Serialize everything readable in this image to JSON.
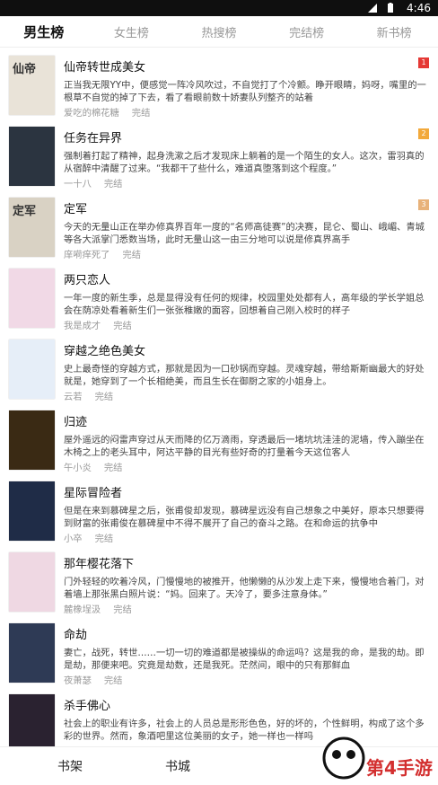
{
  "status_bar": {
    "time": "4:46"
  },
  "tabs": [
    {
      "label": "男生榜",
      "active": true
    },
    {
      "label": "女生榜",
      "active": false
    },
    {
      "label": "热搜榜",
      "active": false
    },
    {
      "label": "完结榜",
      "active": false
    },
    {
      "label": "新书榜",
      "active": false
    }
  ],
  "books": [
    {
      "title": "仙帝转世成美女",
      "desc": "正当我无限YY中，便感觉一阵冷风吹过，不自觉打了个冷颤。睁开眼睛，妈呀，嘴里的一根草不自觉的掉了下去，看了看眼前数十娇妻队列整齐的站着",
      "author": "爱吃的棉花糖",
      "status": "完结",
      "rank": "1",
      "rank_color": "#e53935",
      "cover_color": "#e9e3d8",
      "cover_text": "仙帝"
    },
    {
      "title": "任务在异界",
      "desc": "强制着打起了精神，起身洗漱之后才发现床上躺着的是一个陌生的女人。这次，雷羽真的从宿醉中清醒了过来。“我都干了些什么，难道真堕落到这个程度。”",
      "author": "一十八",
      "status": "完结",
      "rank": "2",
      "rank_color": "#f2a93b",
      "cover_color": "#2b3440",
      "cover_text": ""
    },
    {
      "title": "定军",
      "desc": "今天的无量山正在举办修真界百年一度的“名师高徒赛”的决赛，昆仑、蜀山、峨嵋、青城等各大派掌门悉数当场，此时无量山这一由三分地可以说是修真界高手",
      "author": "庠嗬痒死了",
      "status": "完结",
      "rank": "3",
      "rank_color": "#e8b27a",
      "cover_color": "#d9d2c4",
      "cover_text": "定军"
    },
    {
      "title": "两只恋人",
      "desc": "一年一度的新生季，总是显得没有任何的规律，校园里处处都有人，高年级的学长学姐总会在荫凉处看着新生们一张张稚嫩的面容，回想着自己刚入校时的样子",
      "author": "我是成才",
      "status": "完结",
      "rank": "",
      "rank_color": "",
      "cover_color": "#f1d9e6",
      "cover_text": ""
    },
    {
      "title": "穿越之绝色美女",
      "desc": "史上最奇怪的穿越方式，那就是因为一口砂锅而穿越。灵魂穿越，带给斯斯幽最大的好处就是，她穿到了一个长相绝美，而且生长在御厨之家的小姐身上。",
      "author": "云若",
      "status": "完结",
      "rank": "",
      "rank_color": "",
      "cover_color": "#e6eef8",
      "cover_text": ""
    },
    {
      "title": "归迹",
      "desc": "屋外遥远的闷雷声穿过从天而降的亿万滴雨，穿透最后一堵坑坑洼洼的泥墙，传入蹦坐在木椅之上的老头耳中，阿达平静的目光有些好奇的打量着今天这位客人",
      "author": "午小炎",
      "status": "完结",
      "rank": "",
      "rank_color": "",
      "cover_color": "#3a2a14",
      "cover_text": ""
    },
    {
      "title": "星际冒险者",
      "desc": "但是在来到慕碑星之后，张甫俊却发现，慕碑星远没有自己想象之中美好，原本只想要得到财富的张甫俊在慕碑星中不得不展开了自己的奋斗之路。在和命运的抗争中",
      "author": "小卒",
      "status": "完结",
      "rank": "",
      "rank_color": "",
      "cover_color": "#1f2c47",
      "cover_text": ""
    },
    {
      "title": "那年樱花落下",
      "desc": "门外轻轻的吹着冷风，门慢慢地的被推开，他懒懒的从沙发上走下来，慢慢地合着门，对着墙上那张黑白照片说：“妈。回来了。天冷了，要多注意身体。”",
      "author": "麓橡埕汲",
      "status": "完结",
      "rank": "",
      "rank_color": "",
      "cover_color": "#efd8e3",
      "cover_text": ""
    },
    {
      "title": "命劫",
      "desc": "妻亡，战死，转世……一切一切的难道都是被操纵的命运吗？这是我的命，是我的劫。即是劫，那便来吧。究竟是劫数，还是我死。茫然间，眼中的只有那鲜血",
      "author": "夜萧瑟",
      "status": "完结",
      "rank": "",
      "rank_color": "",
      "cover_color": "#2e3a55",
      "cover_text": ""
    },
    {
      "title": "杀手佛心",
      "desc": "社会上的职业有许多，社会上的人员总是形形色色，好的坏的，个性鲜明，构成了这个多彩的世界。然而，象酒吧里这位美丽的女子，她一样也一样吗",
      "author": "佚名",
      "status": "完结",
      "rank": "",
      "rank_color": "",
      "cover_color": "#2a2230",
      "cover_text": ""
    }
  ],
  "bottom_nav": [
    {
      "label": "书架"
    },
    {
      "label": "书城"
    }
  ],
  "watermark": {
    "text": "第4手游"
  }
}
